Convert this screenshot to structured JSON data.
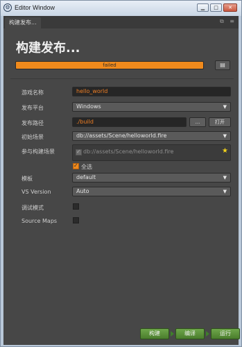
{
  "window": {
    "title": "Editor Window",
    "controls": {
      "minimize": "▁",
      "maximize": "□",
      "close": "✕"
    }
  },
  "tab": {
    "label": "构建发布...",
    "icons": [
      "duplicate-icon",
      "menu-icon"
    ]
  },
  "heading": "构建发布...",
  "progress": {
    "label": "failed",
    "fraction": 1.0,
    "color": "#f08a1c"
  },
  "doc_button_icon": "document-icon",
  "form": {
    "game_name": {
      "label": "游戏名称",
      "value": "hello_world"
    },
    "platform": {
      "label": "发布平台",
      "value": "Windows"
    },
    "build_path": {
      "label": "发布路径",
      "value": "./build",
      "browse_label": "...",
      "open_label": "打开"
    },
    "start_scene": {
      "label": "初始场景",
      "value": "db://assets/Scene/helloworld.fire"
    },
    "included_scenes": {
      "label": "参与构建场景",
      "items": [
        "db://assets/Scene/helloworld.fire"
      ],
      "select_all_label": "全选"
    },
    "template": {
      "label": "模板",
      "value": "default"
    },
    "vs_version": {
      "label": "VS Version",
      "value": "Auto"
    },
    "debug_mode": {
      "label": "调试模式",
      "checked": false
    },
    "source_maps": {
      "label": "Source Maps",
      "checked": false
    }
  },
  "actions": {
    "build": "构建",
    "compile": "编译",
    "run": "运行"
  },
  "colors": {
    "accent": "#f08a1c",
    "green": "#5a9138",
    "panel": "#474747"
  }
}
